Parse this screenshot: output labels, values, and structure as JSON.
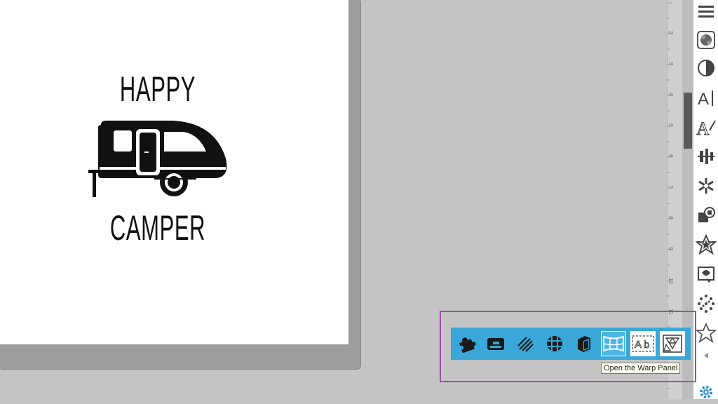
{
  "design": {
    "line1": "HAPPY",
    "line2": "CAMPER"
  },
  "ruler": {
    "numbers": [
      "2",
      "3",
      "4",
      "5",
      "6",
      "7",
      "8",
      "9",
      "10",
      "11"
    ]
  },
  "right_toolbar": {
    "items": [
      {
        "icon": "hamburger-icon"
      },
      {
        "icon": "pattern-fill-icon"
      },
      {
        "icon": "contrast-icon"
      },
      {
        "icon": "text-style-icon"
      },
      {
        "icon": "text-sketch-icon"
      },
      {
        "icon": "align-icon"
      },
      {
        "icon": "replicate-icon"
      },
      {
        "icon": "transform-icon"
      },
      {
        "icon": "star-badge-icon"
      },
      {
        "icon": "image-trace-icon"
      },
      {
        "icon": "dots-effect-icon"
      },
      {
        "icon": "star-outline-icon"
      },
      {
        "icon": "collapse-arrow-icon"
      },
      {
        "icon": "settings-gear-icon"
      }
    ]
  },
  "warp_toolbar": {
    "buttons": [
      {
        "icon": "puzzle-icon"
      },
      {
        "icon": "eraser-icon"
      },
      {
        "icon": "hatch-lines-icon"
      },
      {
        "icon": "grid-circle-icon"
      },
      {
        "icon": "3d-box-icon"
      },
      {
        "icon": "warp-icon",
        "active": true
      },
      {
        "icon": "text-outline-icon"
      },
      {
        "icon": "triangle-pattern-icon"
      }
    ],
    "tooltip": "Open the Warp Panel"
  },
  "colors": {
    "accent": "#3aa7d8",
    "highlight": "#9b4fa8",
    "workspace": "#c4c4c4"
  }
}
